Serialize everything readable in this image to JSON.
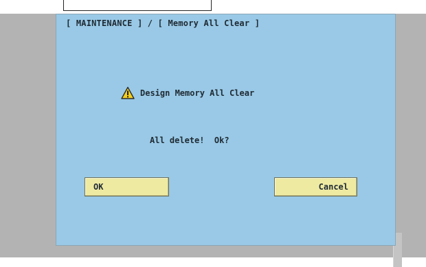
{
  "breadcrumb": "[ MAINTENANCE ] / [ Memory All Clear ]",
  "dialog": {
    "icon": "warning-icon",
    "title": "Design Memory All Clear",
    "message": "All delete!  Ok?"
  },
  "buttons": {
    "ok_label": "OK",
    "cancel_label": "Cancel"
  },
  "colors": {
    "screen_bg": "#99c9e6",
    "bezel": "#b3b3b3",
    "button_bg": "#eeeaa2",
    "warning_yellow": "#f2cf1e",
    "text": "#1f2a33"
  }
}
